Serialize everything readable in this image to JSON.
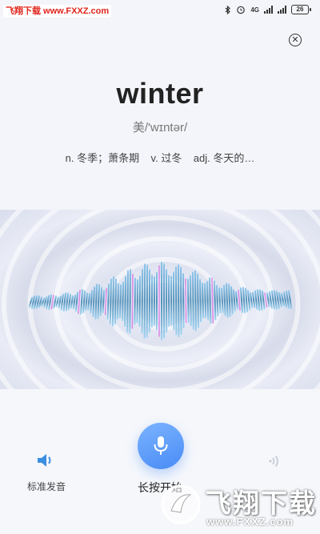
{
  "status_bar": {
    "watermark": "飞翔下载 www.FXXZ.com",
    "network": "4G",
    "battery": "26",
    "icons": [
      "bluetooth-icon",
      "alarm-icon",
      "signal-icon",
      "battery-icon"
    ]
  },
  "close_icon": "close-icon",
  "word": {
    "text": "winter",
    "phonetic": "美/'wɪntər/",
    "definitions": "n. 冬季；萧条期    v. 过冬    adj. 冬天的…"
  },
  "actions": {
    "standard_pronunciation": "标准发音",
    "hold_to_record": "长按开始",
    "mic_icon": "microphone-icon",
    "speaker_icon": "speaker-icon",
    "playback_icon": "playback-icon"
  },
  "bottom_watermark": {
    "brand": "飞翔下载",
    "url": "www.FXXZ.com"
  },
  "colors": {
    "accent": "#4a8cf6",
    "wave_blue": "#5ea3d8",
    "wave_pink": "#d98be6"
  }
}
